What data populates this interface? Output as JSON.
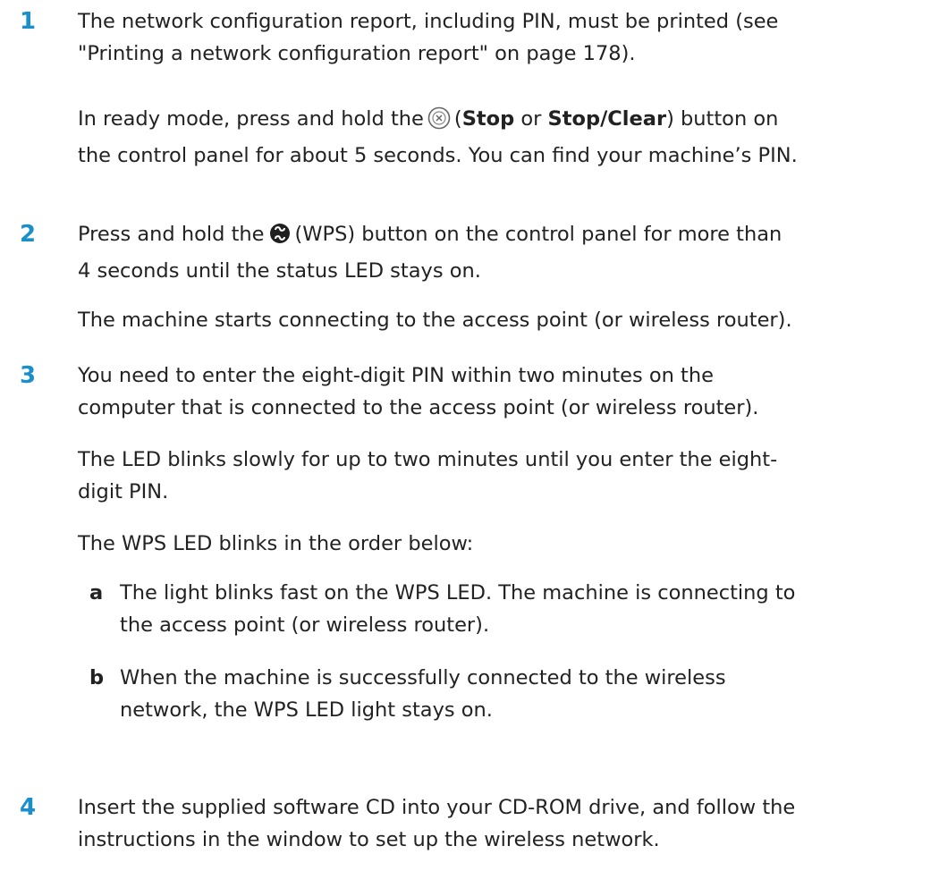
{
  "steps": [
    {
      "number": "1",
      "paragraphs": [
        {
          "line1": "The network configuration report, including PIN, must be printed (see",
          "line2": "\"Printing a network configuration report\" on page 178)."
        },
        {
          "line1_pre": "In ready mode, press and hold the",
          "line1_open": "(",
          "bold1": "Stop",
          "or": " or ",
          "bold2": "Stop/Clear",
          "line1_post": ") button on",
          "line2": "the control panel for about 5 seconds. You can find your machine’s PIN."
        }
      ]
    },
    {
      "number": "2",
      "paragraphs": [
        {
          "line1_pre": "Press and hold the",
          "line1_post": "(WPS) button on the control panel for more than",
          "line2": "4 seconds until the status LED stays on."
        },
        {
          "line1": "The machine starts connecting to the access point (or wireless router)."
        }
      ]
    },
    {
      "number": "3",
      "paragraphs": [
        {
          "line1": "You need to enter the eight-digit PIN within two minutes on the",
          "line2": "computer that is connected to the access point (or wireless router)."
        },
        {
          "line1": "The LED blinks slowly for up to two minutes until you enter the eight-",
          "line2": "digit PIN."
        },
        {
          "line1": "The WPS LED blinks in the order below:"
        }
      ],
      "substeps": [
        {
          "letter": "a",
          "line1": "The light blinks fast on the WPS LED. The machine is connecting to",
          "line2": "the access point (or wireless router)."
        },
        {
          "letter": "b",
          "line1": "When the machine is successfully connected to the wireless",
          "line2": "network, the WPS LED light stays on."
        }
      ]
    },
    {
      "number": "4",
      "paragraphs": [
        {
          "line1": "Insert the supplied software CD into your CD-ROM drive, and follow the",
          "line2": "instructions in the window to set up the wireless network."
        }
      ]
    }
  ],
  "icons": {
    "stop": "stop-clear-icon",
    "wps": "wps-icon"
  },
  "colors": {
    "step_number": "#1a8fc9",
    "text": "#222222"
  }
}
